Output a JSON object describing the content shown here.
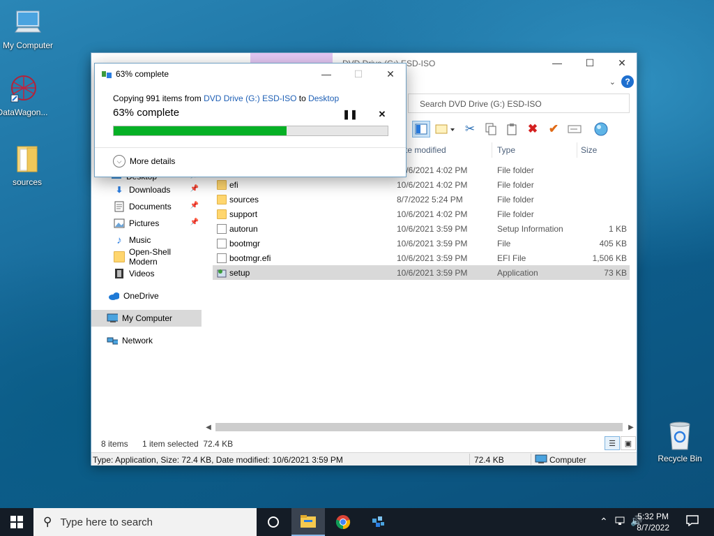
{
  "desktop": {
    "icons": [
      {
        "label": "My Computer"
      },
      {
        "label": "DataWagon..."
      },
      {
        "label": "sources"
      },
      {
        "label": "Recycle Bin"
      }
    ]
  },
  "explorer": {
    "title": "DVD Drive (G:) ESD-ISO",
    "manage_tab": "Manage",
    "search_placeholder": "Search DVD Drive (G:) ESD-ISO",
    "columns": {
      "date": "te modified",
      "type": "Type",
      "size": "Size"
    },
    "nav": [
      {
        "label": "Desktop",
        "pinned": true
      },
      {
        "label": "Downloads",
        "pinned": true
      },
      {
        "label": "Documents",
        "pinned": true
      },
      {
        "label": "Pictures",
        "pinned": true
      },
      {
        "label": "Music",
        "pinned": false
      },
      {
        "label": "Open-Shell Modern",
        "pinned": false
      },
      {
        "label": "Videos",
        "pinned": false
      },
      {
        "label": "OneDrive",
        "pinned": false
      },
      {
        "label": "My Computer",
        "pinned": false
      },
      {
        "label": "Network",
        "pinned": false
      }
    ],
    "files": [
      {
        "name": "",
        "date": "10/6/2021 4:02 PM",
        "type": "File folder",
        "size": ""
      },
      {
        "name": "efi",
        "date": "10/6/2021 4:02 PM",
        "type": "File folder",
        "size": ""
      },
      {
        "name": "sources",
        "date": "8/7/2022 5:24 PM",
        "type": "File folder",
        "size": ""
      },
      {
        "name": "support",
        "date": "10/6/2021 4:02 PM",
        "type": "File folder",
        "size": ""
      },
      {
        "name": "autorun",
        "date": "10/6/2021 3:59 PM",
        "type": "Setup Information",
        "size": "1 KB"
      },
      {
        "name": "bootmgr",
        "date": "10/6/2021 3:59 PM",
        "type": "File",
        "size": "405 KB"
      },
      {
        "name": "bootmgr.efi",
        "date": "10/6/2021 3:59 PM",
        "type": "EFI File",
        "size": "1,506 KB"
      },
      {
        "name": "setup",
        "date": "10/6/2021 3:59 PM",
        "type": "Application",
        "size": "73 KB"
      }
    ],
    "status_items": "8 items",
    "status_selected": "1 item selected  72.4 KB",
    "details_bar": "Type: Application, Size: 72.4 KB, Date modified: 10/6/2021 3:59 PM",
    "details_size": "72.4 KB",
    "details_location": "Computer"
  },
  "copy_dialog": {
    "title": "63% complete",
    "line_prefix": "Copying 991 items from ",
    "source": "DVD Drive (G:) ESD-ISO",
    "line_mid": " to ",
    "destination": "Desktop",
    "percent_text": "63% complete",
    "progress": 0.63,
    "more_details": "More details"
  },
  "taskbar": {
    "search_placeholder": "Type here to search",
    "time": "5:32 PM",
    "date": "8/7/2022"
  },
  "colors": {
    "progress_fill": "#06b025",
    "link": "#1e5fb5",
    "taskbar": "#141c26"
  }
}
